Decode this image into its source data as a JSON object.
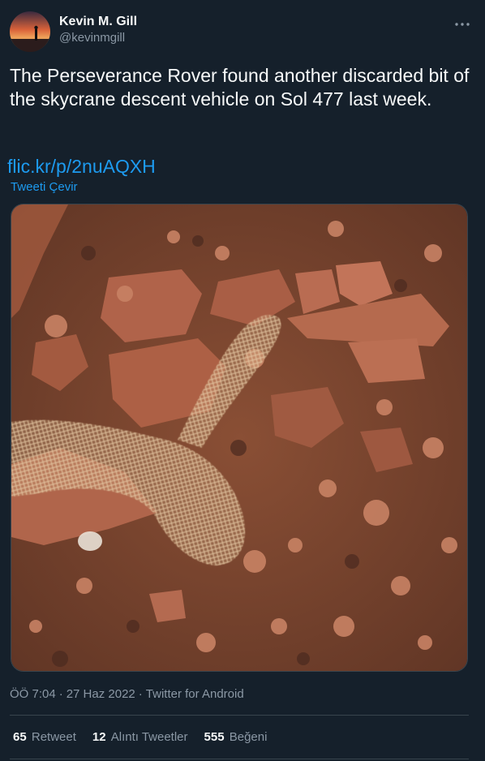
{
  "author": {
    "name": "Kevin M. Gill",
    "handle": "@kevinmgill"
  },
  "tweet": {
    "text": "The Perseverance Rover found another discarded bit of the skycrane descent vehicle on Sol 477 last week.",
    "link": "flic.kr/p/2nuAQXH",
    "translate_label": "Tweeti Çevir"
  },
  "meta": {
    "time": "ÖÖ 7:04",
    "sep1": "·",
    "date": "27 Haz 2022",
    "sep2": "·",
    "source": "Twitter for Android"
  },
  "stats": {
    "retweets": {
      "count": "65",
      "label": "Retweet"
    },
    "quotes": {
      "count": "12",
      "label": "Alıntı Tweetler"
    },
    "likes": {
      "count": "555",
      "label": "Beğeni"
    }
  },
  "icons": {
    "more": "more-horizontal-icon"
  },
  "colors": {
    "background": "#15202b",
    "accent": "#1d9bf0",
    "secondary_text": "#8b98a5",
    "border": "#38444d"
  }
}
